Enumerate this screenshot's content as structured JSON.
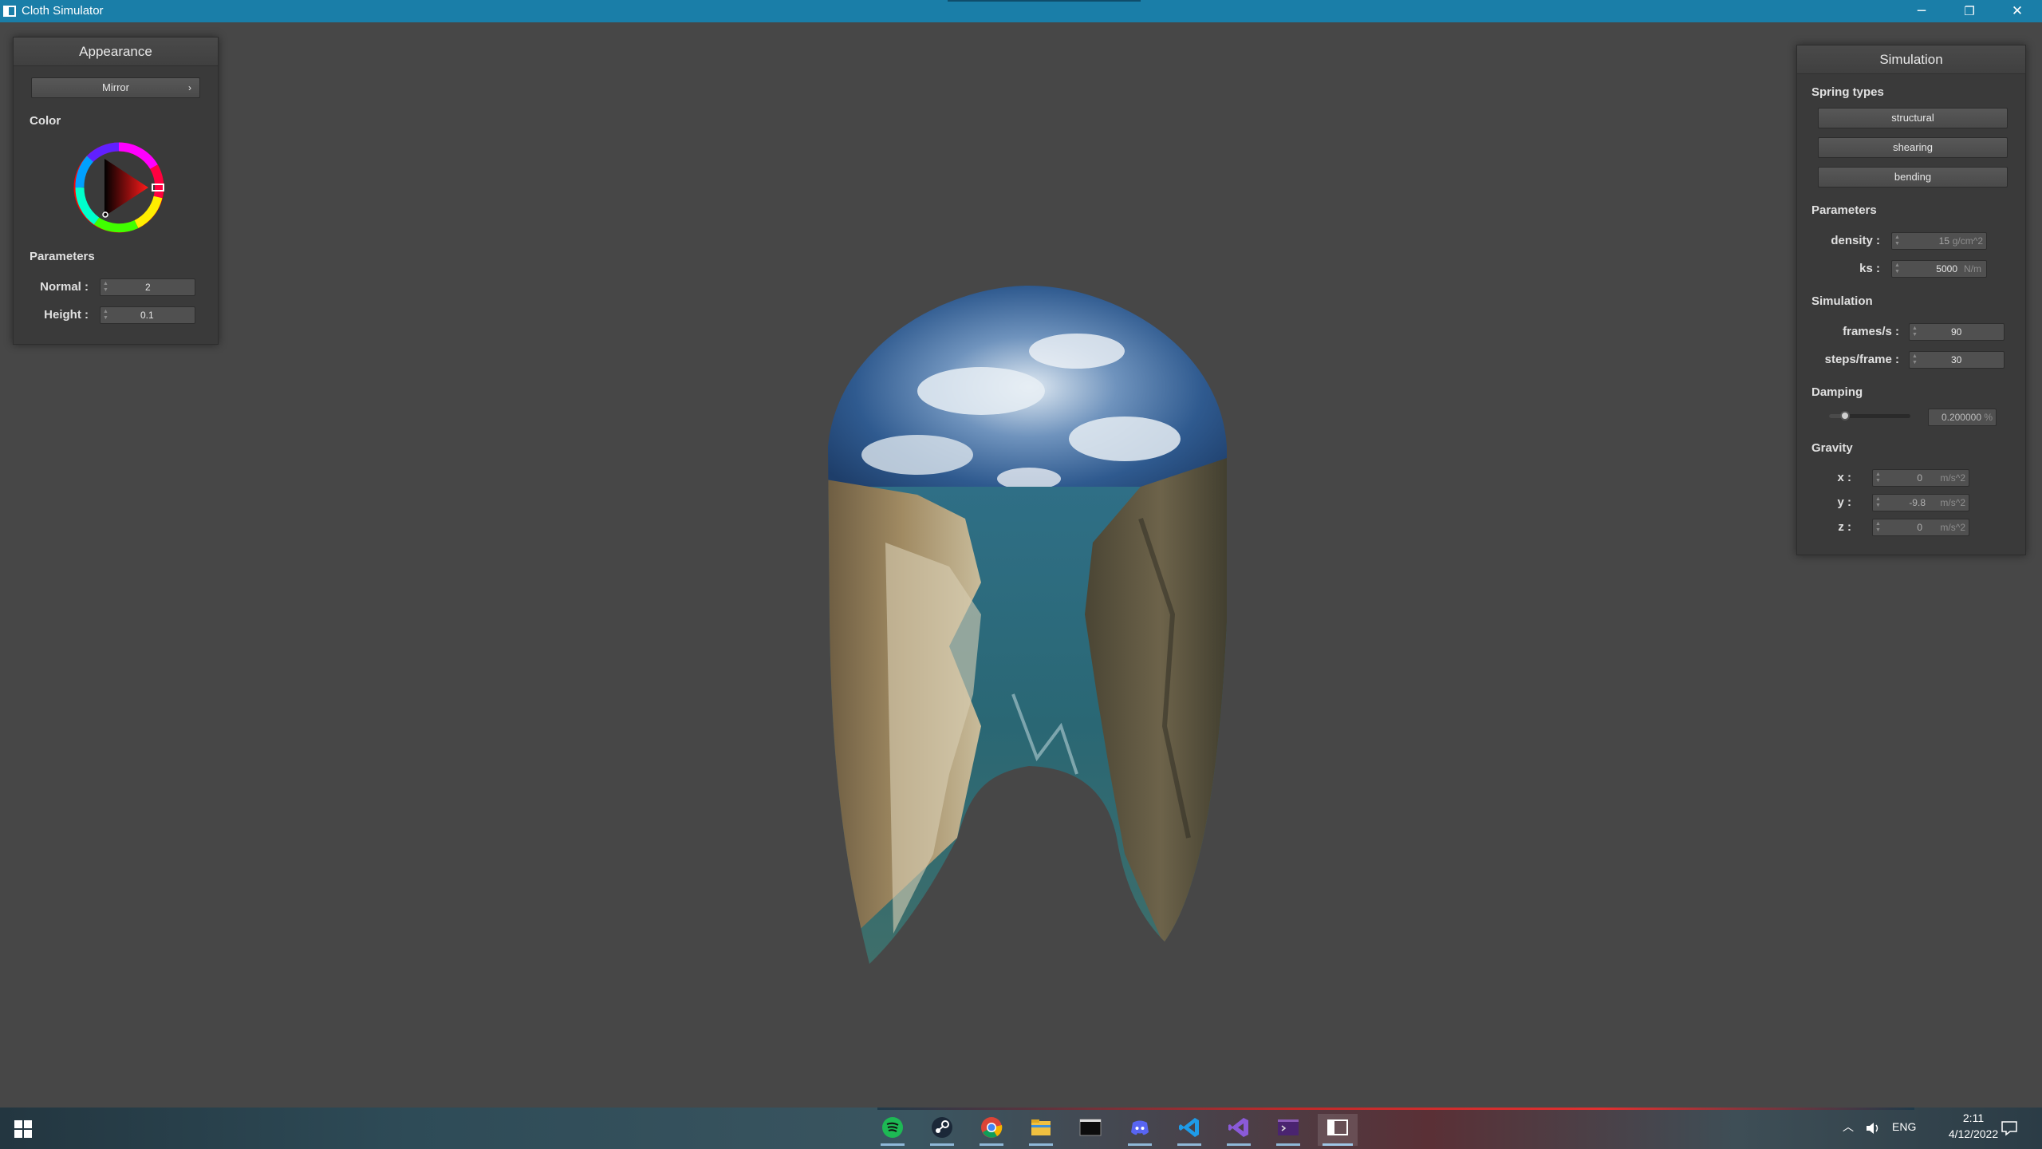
{
  "window": {
    "title": "Cloth Simulator",
    "minimize_glyph": "─",
    "maximize_glyph": "❐",
    "close_glyph": "✕"
  },
  "appearance_panel": {
    "title": "Appearance",
    "material_dropdown": "Mirror",
    "color_section": "Color",
    "parameters_section": "Parameters",
    "normal_label": "Normal :",
    "normal_value": "2",
    "height_label": "Height :",
    "height_value": "0.1"
  },
  "simulation_panel": {
    "title": "Simulation",
    "spring_types_section": "Spring types",
    "spring_buttons": [
      "structural",
      "shearing",
      "bending"
    ],
    "parameters_section": "Parameters",
    "density_label": "density :",
    "density_value": "15",
    "density_unit": "g/cm^2",
    "ks_label": "ks :",
    "ks_value": "5000",
    "ks_unit": "N/m",
    "simulation_section": "Simulation",
    "fps_label": "frames/s :",
    "fps_value": "90",
    "steps_label": "steps/frame :",
    "steps_value": "30",
    "damping_section": "Damping",
    "damping_value": "0.200000",
    "damping_unit": "%",
    "damping_fraction": 0.2,
    "gravity_section": "Gravity",
    "gx_label": "x :",
    "gx_value": "0",
    "gy_label": "y :",
    "gy_value": "-9.8",
    "gz_label": "z :",
    "gz_value": "0",
    "gravity_unit": "m/s^2"
  },
  "taskbar": {
    "apps": [
      "spotify-icon",
      "steam-icon",
      "chrome-icon",
      "file-explorer-icon",
      "terminal-icon",
      "discord-icon",
      "vscode-icon",
      "visual-studio-icon",
      "terminal-purple-icon",
      "cloth-simulator-icon"
    ],
    "language": "ENG",
    "time": "2:11",
    "date": "4/12/2022"
  },
  "colors": {
    "titlebar": "#1a7ea8",
    "viewport": "#474747",
    "panel": "#3a3a3a"
  }
}
